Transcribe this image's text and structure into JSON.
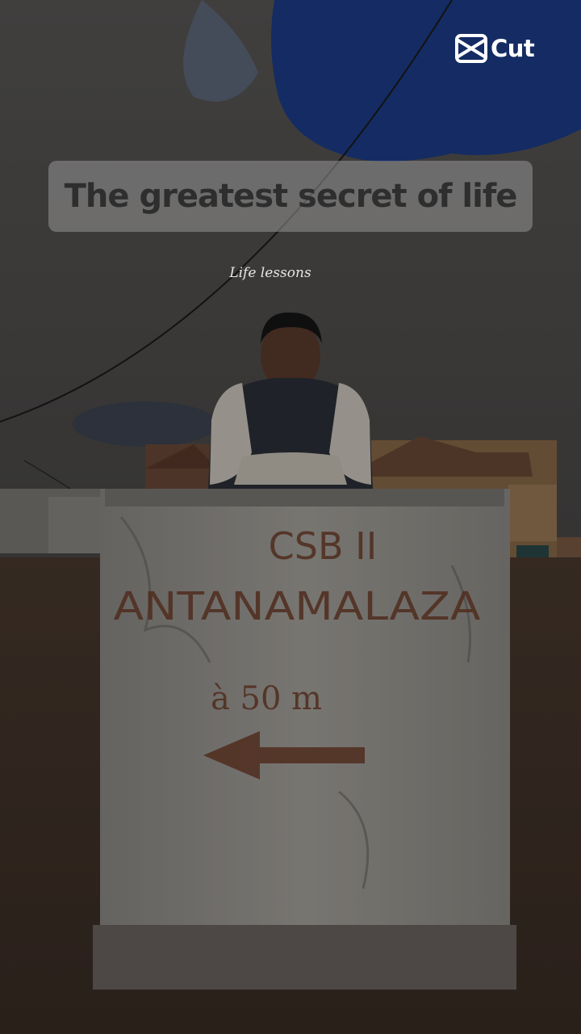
{
  "brand": {
    "logo_text": "Cut",
    "icon": "capcut-logo-icon"
  },
  "overlay": {
    "title": "The greatest secret of life",
    "subtitle": "Life lessons"
  },
  "photo": {
    "sign_line1": "CSB II",
    "sign_line2": "ANTANAMALAZA",
    "sign_line3": "à 50 m",
    "arrow_icon": "arrow-left-icon"
  },
  "colors": {
    "sky": "#1d3e8a",
    "title_box": "#8e8e8e",
    "title_text": "#2e2e2e",
    "sign_text": "#6e3e2a"
  }
}
